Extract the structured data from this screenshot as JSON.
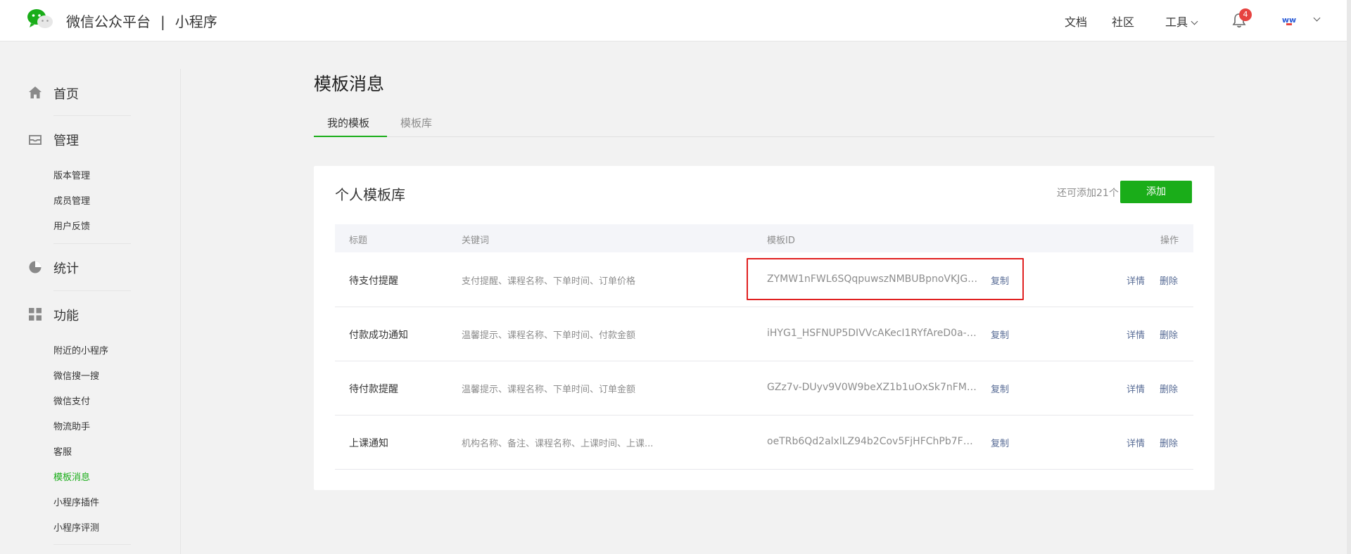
{
  "header": {
    "brand": "微信公众平台",
    "separator": "|",
    "product": "小程序",
    "nav": {
      "docs": "文档",
      "community": "社区",
      "tools": "工具"
    },
    "notification_count": "4",
    "avatar_text": "ww"
  },
  "sidebar": {
    "sections": [
      {
        "label": "首页",
        "icon": "home-icon",
        "items": []
      },
      {
        "label": "管理",
        "icon": "inbox-icon",
        "items": [
          "版本管理",
          "成员管理",
          "用户反馈"
        ]
      },
      {
        "label": "统计",
        "icon": "pie-chart-icon",
        "items": []
      },
      {
        "label": "功能",
        "icon": "grid-icon",
        "items": [
          "附近的小程序",
          "微信搜一搜",
          "微信支付",
          "物流助手",
          "客服",
          "模板消息",
          "小程序插件",
          "小程序评测"
        ]
      }
    ],
    "active_item": "模板消息"
  },
  "main": {
    "title": "模板消息",
    "tabs": [
      {
        "label": "我的模板",
        "active": true
      },
      {
        "label": "模板库",
        "active": false
      }
    ],
    "card": {
      "title": "个人模板库",
      "remaining": "还可添加21个",
      "add_label": "添加",
      "columns": [
        "标题",
        "关键词",
        "模板ID",
        "操作"
      ],
      "rows": [
        {
          "title": "待支付提醒",
          "keywords": "支付提醒、课程名称、下单时间、订单价格",
          "id": "ZYMW1nFWL6SQqpuwszNMBUBpnoVKJGi...",
          "copy": "复制",
          "detail": "详情",
          "delete": "删除"
        },
        {
          "title": "付款成功通知",
          "keywords": "温馨提示、课程名称、下单时间、付款金额",
          "id": "iHYG1_HSFNUP5DIVVcAKecI1RYfAreD0a-iI...",
          "copy": "复制",
          "detail": "详情",
          "delete": "删除"
        },
        {
          "title": "待付款提醒",
          "keywords": "温馨提示、课程名称、下单时间、订单金额",
          "id": "GZz7v-DUyv9V0W9beXZ1b1uOxSk7nFMG...",
          "copy": "复制",
          "detail": "详情",
          "delete": "删除"
        },
        {
          "title": "上课通知",
          "keywords": "机构名称、备注、课程名称、上课时间、上课...",
          "id": "oeTRb6Qd2alxlLZ94b2Cov5FjHFChPb7FNg...",
          "copy": "复制",
          "detail": "详情",
          "delete": "删除"
        }
      ]
    }
  },
  "colors": {
    "accent": "#1aad19",
    "link": "#576b95",
    "highlight": "#e02020",
    "badge": "#e64340"
  }
}
